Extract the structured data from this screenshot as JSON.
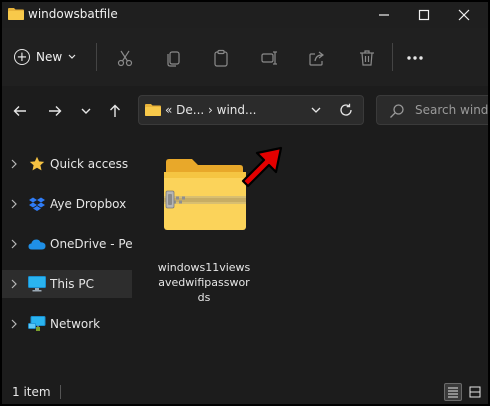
{
  "window": {
    "title": "windowsbatfile",
    "controls": [
      "minimize-icon",
      "maximize-icon",
      "close-icon"
    ]
  },
  "toolbar": {
    "new_label": "New",
    "actions": [
      "cut-icon",
      "copy-icon",
      "paste-icon",
      "rename-icon",
      "share-icon",
      "delete-icon",
      "more-icon"
    ]
  },
  "navigation": {
    "buttons": [
      "back-arrow-icon",
      "forward-arrow-icon",
      "recent-locations-chevron-icon",
      "up-arrow-icon"
    ]
  },
  "address": {
    "path_text": "«  De...  ›  wind..."
  },
  "search": {
    "placeholder": "Search windows"
  },
  "sidebar": {
    "items": [
      {
        "label": "Quick access",
        "icon": "star-icon",
        "selected": false
      },
      {
        "label": "Aye Dropbox",
        "icon": "dropbox-icon",
        "selected": false
      },
      {
        "label": "OneDrive - Pers",
        "icon": "cloud-icon",
        "selected": false
      },
      {
        "label": "This PC",
        "icon": "monitor-icon",
        "selected": true
      },
      {
        "label": "Network",
        "icon": "network-icon",
        "selected": false
      }
    ]
  },
  "content": {
    "files": [
      {
        "name": "windows11viewsavedwifipasswords",
        "icon": "zip-folder-icon"
      }
    ]
  },
  "status": {
    "item_count": "1 item"
  },
  "colors": {
    "background": "#1c1c1c",
    "folder_yellow": "#f8c94a",
    "accent_red": "#e30000"
  }
}
